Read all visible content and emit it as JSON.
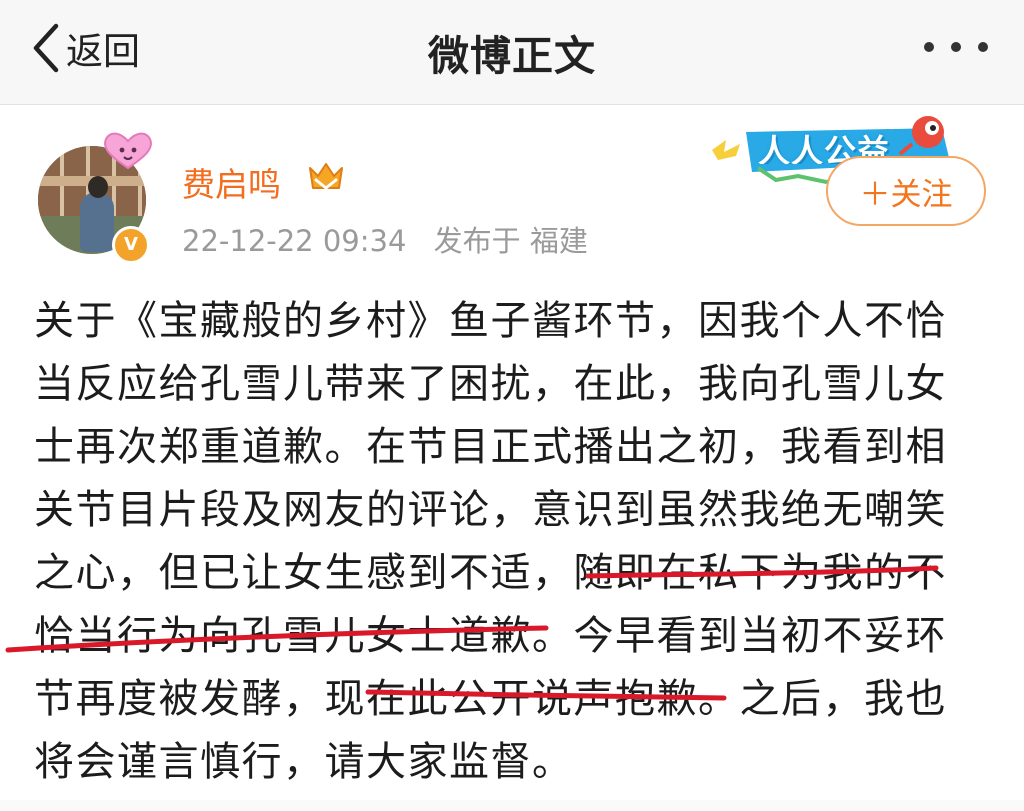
{
  "nav": {
    "back_label": "返回",
    "title": "微博正文",
    "more_icon": "more-dots-icon"
  },
  "author": {
    "name": "费启鸣",
    "timestamp": "22-12-22 09:34",
    "location": "发布于 福建",
    "verified_icon": "verified-v-icon",
    "level_icon": "vip-crown-icon"
  },
  "campaign": {
    "text": "人人公益",
    "icon": "charity-mascot-icon"
  },
  "follow_button": "＋关注",
  "post": {
    "lines": [
      "关于《宝藏般的乡村》鱼子酱环节，因我个人不恰",
      "当反应给孔雪儿带来了困扰，在此，我向孔雪儿女",
      "士再次郑重道歉。在节目正式播出之初，我看到相",
      "关节目片段及网友的评论，意识到虽然我绝无嘲笑",
      "之心，但已让女生感到不适，随即在私下为我的不",
      "恰当行为向孔雪儿女士道歉。今早看到当初不妥环",
      "节再度被发酵，现在此公开说声抱歉。之后，我也",
      "将会谨言慎行，请大家监督。"
    ]
  },
  "colors": {
    "accent_orange": "#f26d1e",
    "underline_red": "#d9182a",
    "meta_gray": "#9a9a9a"
  }
}
